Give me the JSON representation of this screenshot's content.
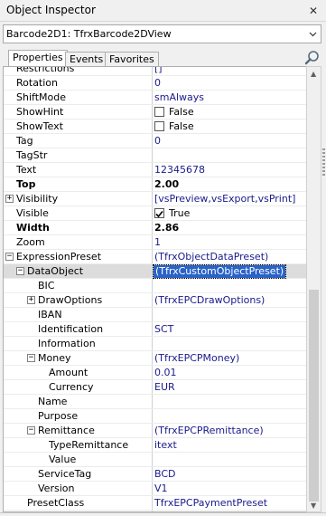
{
  "window": {
    "title": "Object Inspector"
  },
  "combo": {
    "value": "Barcode2D1: TfrxBarcode2DView"
  },
  "tabs": [
    {
      "label": "Properties",
      "active": true
    },
    {
      "label": "Events",
      "active": false
    },
    {
      "label": "Favorites",
      "active": false
    }
  ],
  "icons": {
    "close": "close-icon",
    "dropdown": "chevron-down-icon",
    "search": "search-icon"
  },
  "properties": [
    {
      "name": "Restrictions",
      "value": "[]",
      "indent": 0,
      "value_color": "blue",
      "partial": true
    },
    {
      "name": "Rotation",
      "value": "0",
      "indent": 0,
      "value_color": "blue"
    },
    {
      "name": "ShiftMode",
      "value": "smAlways",
      "indent": 0,
      "value_color": "blue"
    },
    {
      "name": "ShowHint",
      "value": "False",
      "indent": 0,
      "checkbox": true,
      "checked": false
    },
    {
      "name": "ShowText",
      "value": "False",
      "indent": 0,
      "checkbox": true,
      "checked": false
    },
    {
      "name": "Tag",
      "value": "0",
      "indent": 0,
      "value_color": "blue"
    },
    {
      "name": "TagStr",
      "value": "",
      "indent": 0
    },
    {
      "name": "Text",
      "value": "12345678",
      "indent": 0,
      "value_color": "blue"
    },
    {
      "name": "Top",
      "value": "2.00",
      "indent": 0,
      "bold": true
    },
    {
      "name": "Visibility",
      "value": "[vsPreview,vsExport,vsPrint]",
      "indent": 0,
      "toggle": "+",
      "value_color": "blue"
    },
    {
      "name": "Visible",
      "value": "True",
      "indent": 0,
      "checkbox": true,
      "checked": true
    },
    {
      "name": "Width",
      "value": "2.86",
      "indent": 0,
      "bold": true
    },
    {
      "name": "Zoom",
      "value": "1",
      "indent": 0,
      "value_color": "blue"
    },
    {
      "name": "ExpressionPreset",
      "value": "(TfrxObjectDataPreset)",
      "indent": 0,
      "toggle": "−",
      "value_color": "blue"
    },
    {
      "name": "DataObject",
      "value": "(TfrxCustomObjectPreset)",
      "indent": 1,
      "toggle": "−",
      "selected": true,
      "highlight": true
    },
    {
      "name": "BIC",
      "value": "",
      "indent": 2
    },
    {
      "name": "DrawOptions",
      "value": "(TfrxEPCDrawOptions)",
      "indent": 2,
      "toggle": "+",
      "value_color": "blue"
    },
    {
      "name": "IBAN",
      "value": "",
      "indent": 2
    },
    {
      "name": "Identification",
      "value": "SCT",
      "indent": 2,
      "value_color": "blue"
    },
    {
      "name": "Information",
      "value": "",
      "indent": 2
    },
    {
      "name": "Money",
      "value": "(TfrxEPCPMoney)",
      "indent": 2,
      "toggle": "−",
      "value_color": "blue"
    },
    {
      "name": "Amount",
      "value": "0.01",
      "indent": 3,
      "value_color": "blue"
    },
    {
      "name": "Currency",
      "value": "EUR",
      "indent": 3,
      "value_color": "blue"
    },
    {
      "name": "Name",
      "value": "",
      "indent": 2
    },
    {
      "name": "Purpose",
      "value": "",
      "indent": 2
    },
    {
      "name": "Remittance",
      "value": "(TfrxEPCPRemittance)",
      "indent": 2,
      "toggle": "−",
      "value_color": "blue"
    },
    {
      "name": "TypeRemittance",
      "value": "itext",
      "indent": 3,
      "value_color": "blue"
    },
    {
      "name": "Value",
      "value": "",
      "indent": 3
    },
    {
      "name": "ServiceTag",
      "value": "BCD",
      "indent": 2,
      "value_color": "blue"
    },
    {
      "name": "Version",
      "value": "V1",
      "indent": 2,
      "value_color": "blue"
    },
    {
      "name": "PresetClass",
      "value": "TfrxEPCPaymentPreset",
      "indent": 1,
      "value_color": "blue"
    }
  ]
}
